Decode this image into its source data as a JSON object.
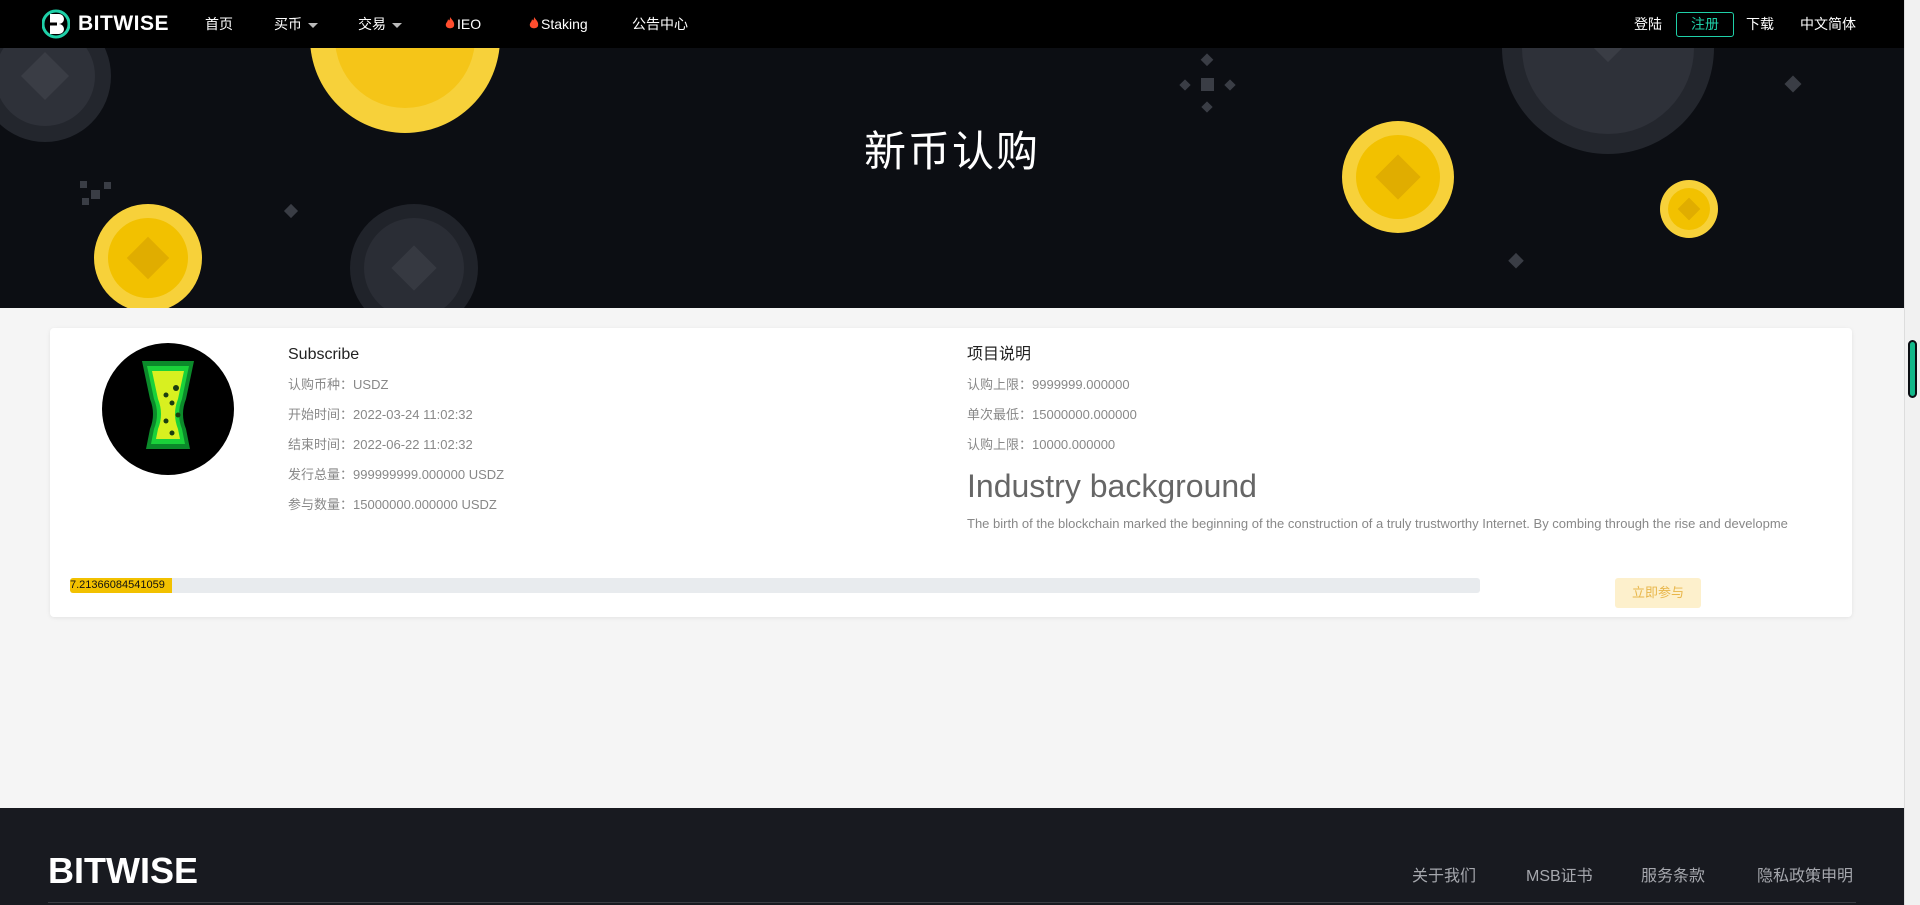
{
  "nav": {
    "brand": "BITWISE",
    "items": [
      {
        "label": "首页"
      },
      {
        "label": "买币"
      },
      {
        "label": "交易"
      },
      {
        "label": "IEO"
      },
      {
        "label": "Staking"
      },
      {
        "label": "公告中心"
      }
    ],
    "login": "登陆",
    "register": "注册",
    "download": "下载",
    "language": "中文简体"
  },
  "hero": {
    "title": "新币认购"
  },
  "subscribe": {
    "title": "Subscribe",
    "rows": [
      {
        "key": "认购币种：",
        "value": "USDZ"
      },
      {
        "key": "开始时间：",
        "value": "2022-03-24 11:02:32"
      },
      {
        "key": "结束时间：",
        "value": "2022-06-22 11:02:32"
      },
      {
        "key": "发行总量：",
        "value": "999999999.000000 USDZ"
      },
      {
        "key": "参与数量：",
        "value": "15000000.000000 USDZ"
      }
    ]
  },
  "project": {
    "title": "项目说明",
    "rows": [
      {
        "key": "认购上限：",
        "value": "9999999.000000"
      },
      {
        "key": "单次最低：",
        "value": "15000000.000000"
      },
      {
        "key": "认购上限：",
        "value": "10000.000000"
      }
    ],
    "industry_title": "Industry background",
    "industry_text": "The birth of the blockchain marked the beginning of the construction of a truly trustworthy Internet. By combing through the rise and developme"
  },
  "progress": {
    "label": "7.21366084541059",
    "fraction": 0.0721
  },
  "join_button": "立即参与",
  "footer": {
    "brand": "BITWISE",
    "links": [
      "关于我们",
      "MSB证书",
      "服务条款",
      "隐私政策申明"
    ]
  },
  "colors": {
    "accent": "#1fd0a8",
    "gold": "#f2c100",
    "nav_bg": "#000000",
    "hero_bg": "#0c0e13",
    "footer_bg": "#181a20"
  }
}
